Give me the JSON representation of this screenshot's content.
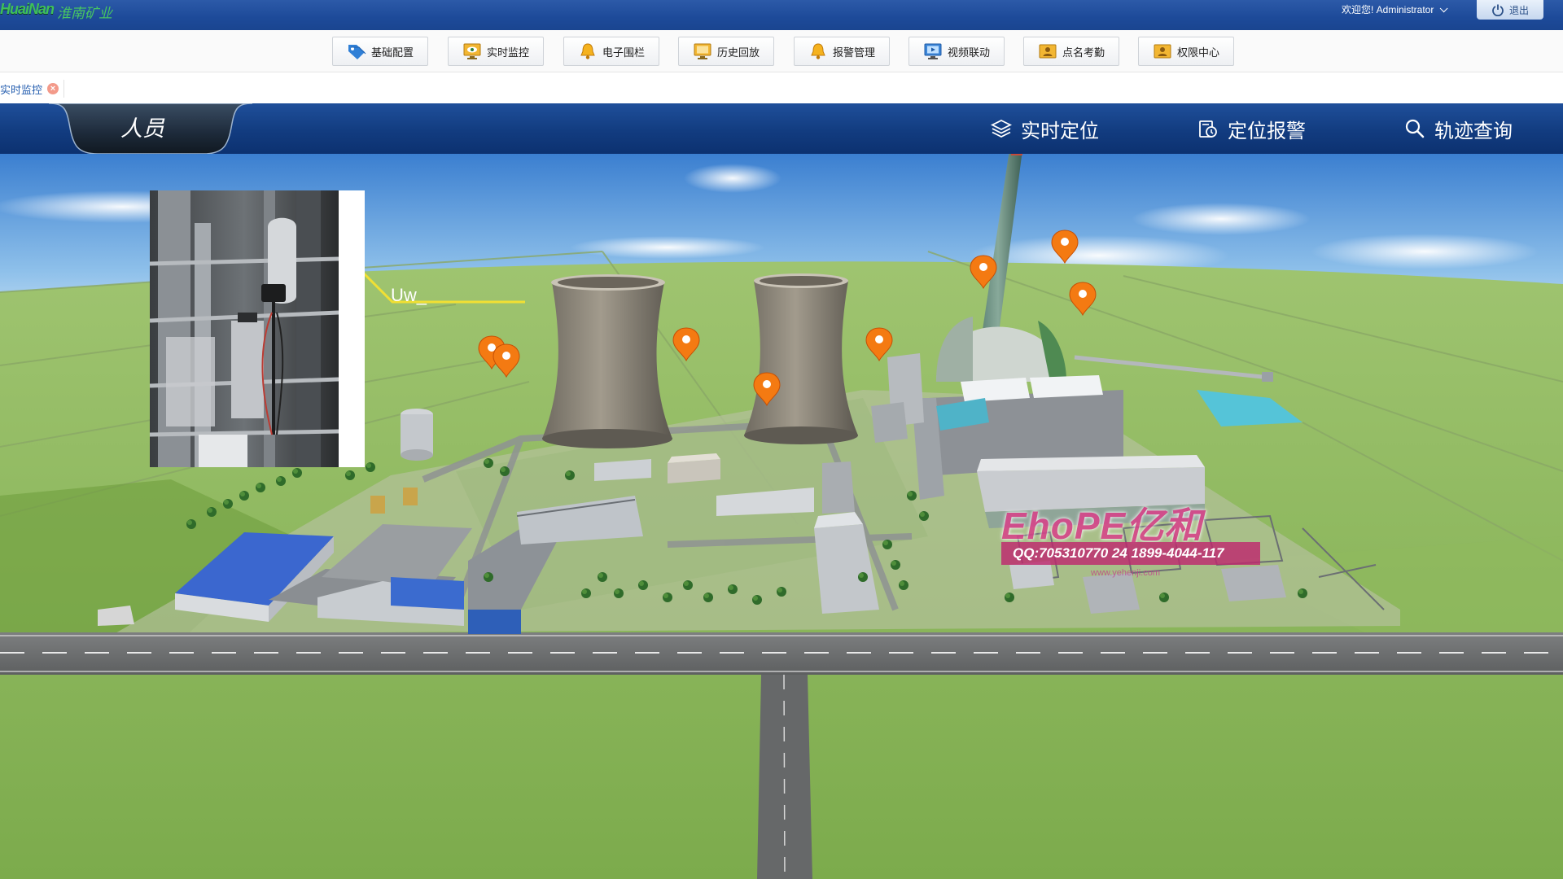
{
  "header": {
    "logo_mark": "HuaiNan",
    "logo_name": "淮南矿业",
    "welcome_text": "欢迎您! Administrator",
    "logout_label": "退出"
  },
  "toolbar": {
    "items": [
      {
        "label": "基础配置",
        "icon": "tag-icon"
      },
      {
        "label": "实时监控",
        "icon": "monitor-eye-icon"
      },
      {
        "label": "电子围栏",
        "icon": "bell-icon"
      },
      {
        "label": "历史回放",
        "icon": "monitor-icon"
      },
      {
        "label": "报警管理",
        "icon": "bell-icon"
      },
      {
        "label": "视频联动",
        "icon": "video-monitor-icon"
      },
      {
        "label": "点名考勤",
        "icon": "id-card-icon"
      },
      {
        "label": "权限中心",
        "icon": "id-card-icon"
      }
    ]
  },
  "tabs": [
    {
      "label": "实时监控",
      "closable": true
    }
  ],
  "nav": {
    "category": "人员",
    "items": [
      {
        "label": "实时定位",
        "icon": "layers-icon"
      },
      {
        "label": "定位报警",
        "icon": "alarm-doc-icon"
      },
      {
        "label": "轨迹查询",
        "icon": "search-icon"
      }
    ]
  },
  "scene": {
    "callout_label": "Uw_",
    "marker_color": "#f47a12",
    "location_markers": 8
  },
  "watermark": {
    "brand": "EhoPE亿和",
    "contact": "QQ:705310770  24 1899-4044-117",
    "url": "www.yehenji.com"
  },
  "colors": {
    "header_blue": "#1d4a99",
    "nav_blue": "#123c80",
    "ground_green": "#8cb85a",
    "marker_orange": "#f47a12"
  }
}
